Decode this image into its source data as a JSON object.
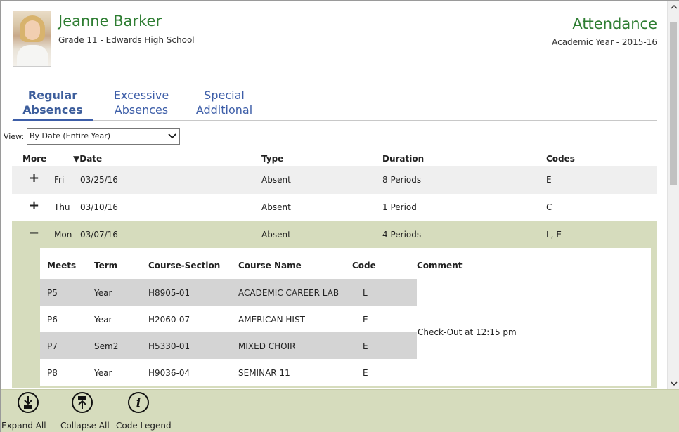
{
  "student": {
    "name": "Jeanne Barker",
    "grade_school": "Grade 11 - Edwards High School"
  },
  "page": {
    "title": "Attendance",
    "academic_year": "Academic Year - 2015-16"
  },
  "tabs": [
    {
      "line1": "Regular",
      "line2": "Absences",
      "active": true
    },
    {
      "line1": "Excessive",
      "line2": "Absences",
      "active": false
    },
    {
      "line1": "Special",
      "line2": "Additional",
      "active": false
    }
  ],
  "view": {
    "label": "View:",
    "selected": "By Date (Entire Year)"
  },
  "columns": {
    "more": "More",
    "date": "▼Date",
    "type": "Type",
    "duration": "Duration",
    "codes": "Codes"
  },
  "rows": [
    {
      "toggle": "+",
      "day": "Fri",
      "date": "03/25/16",
      "type": "Absent",
      "duration": "8 Periods",
      "codes": "E"
    },
    {
      "toggle": "+",
      "day": "Thu",
      "date": "03/10/16",
      "type": "Absent",
      "duration": "1 Period",
      "codes": "C"
    },
    {
      "toggle": "−",
      "day": "Mon",
      "date": "03/07/16",
      "type": "Absent",
      "duration": "4 Periods",
      "codes": "L, E"
    }
  ],
  "detail": {
    "headers": {
      "meets": "Meets",
      "term": "Term",
      "course_section": "Course-Section",
      "course_name": "Course Name",
      "code": "Code",
      "comment": "Comment"
    },
    "rows": [
      {
        "meets": "P5",
        "term": "Year",
        "section": "H8905-01",
        "name": "ACADEMIC CAREER LAB",
        "code": "L"
      },
      {
        "meets": "P6",
        "term": "Year",
        "section": "H2060-07",
        "name": "AMERICAN HIST",
        "code": "E"
      },
      {
        "meets": "P7",
        "term": "Sem2",
        "section": "H5330-01",
        "name": "MIXED CHOIR",
        "code": "E"
      },
      {
        "meets": "P8",
        "term": "Year",
        "section": "H9036-04",
        "name": "SEMINAR 11",
        "code": "E"
      }
    ],
    "comment": "Check-Out at 12:15 pm"
  },
  "footer": {
    "expand_all": "Expand All",
    "collapse_all": "Collapse All",
    "code_legend": "Code Legend"
  },
  "colors": {
    "accent_green": "#2e7d32",
    "tab_blue": "#3d5ea8",
    "expanded_row": "#d6dcbd",
    "stripe": "#efefef"
  }
}
